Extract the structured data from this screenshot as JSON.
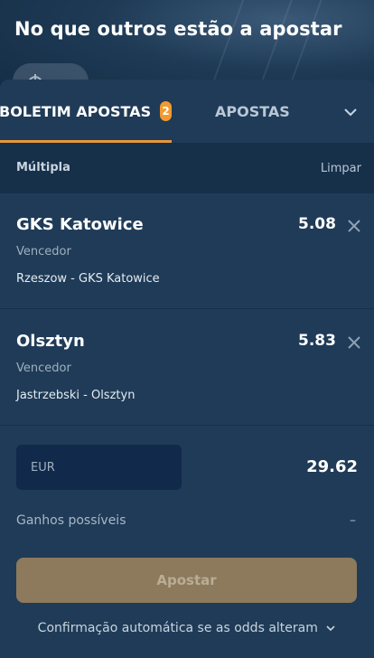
{
  "header": {
    "title": "No que outros estão a apostar"
  },
  "tabs": {
    "betslip_label": "BOLETIM APOSTAS",
    "betslip_count": "2",
    "bets_label": "APOSTAS"
  },
  "slip": {
    "type_label": "Múltipla",
    "clear_label": "Limpar",
    "selections": [
      {
        "team": "GKS Katowice",
        "odds": "5.08",
        "market": "Vencedor",
        "match": "Rzeszow - GKS Katowice"
      },
      {
        "team": "Olsztyn",
        "odds": "5.83",
        "market": "Vencedor",
        "match": "Jastrzebski - Olsztyn"
      }
    ],
    "stake_placeholder": "EUR",
    "total_odds": "29.62",
    "possible_winnings_label": "Ganhos possíveis",
    "possible_winnings_value": "–",
    "place_bet_label": "Apostar",
    "auto_confirm_label": "Confirmação automática se as odds alteram"
  },
  "colors": {
    "accent": "#e8963a",
    "badge": "#f39a2e",
    "panel": "#1f3b57",
    "button_disabled": "#8d7a5c"
  }
}
